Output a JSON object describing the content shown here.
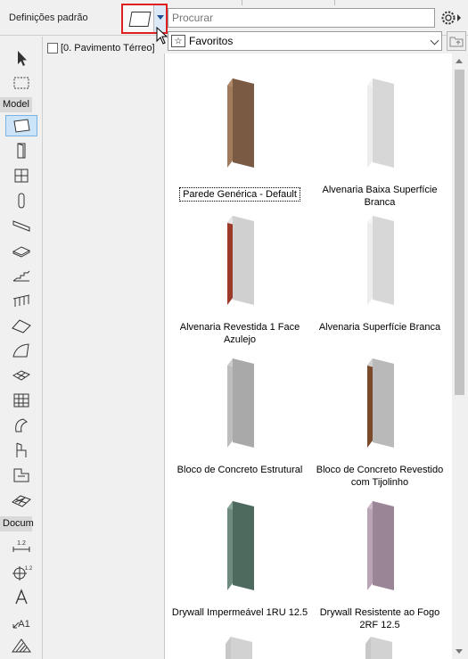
{
  "header": {
    "title": "Definições padrão",
    "search_placeholder": "Procurar",
    "favorites_label": "Favoritos",
    "default_tool_icon": "wall-icon"
  },
  "story": {
    "label": "[0. Pavimento Térreo]"
  },
  "toolbox": {
    "sections": [
      {
        "label": "Model"
      },
      {
        "label": "Docum"
      }
    ],
    "tools": [
      "arrow-icon",
      "marquee-icon",
      "wall-icon",
      "door-icon",
      "window-icon",
      "column-icon",
      "beam-icon",
      "slab-icon",
      "stair-icon",
      "railing-icon",
      "roof-icon",
      "shell-icon",
      "mesh-icon",
      "curtain-wall-icon",
      "morph-icon",
      "object-icon",
      "zone-icon",
      "mesh-surface-icon",
      "dimension-icon",
      "level-dimension-icon",
      "text-icon",
      "label-icon",
      "fill-icon"
    ],
    "dimension_value": "1.2"
  },
  "favorites": [
    {
      "name": "Parede Genérica - Default",
      "colors": {
        "face": "#7a5a43",
        "side": "#a07a5a",
        "top": "#b08866"
      }
    },
    {
      "name": "Alvenaria Baixa Superfície Branca",
      "colors": {
        "face": "#d7d7d7",
        "side": "#ececec",
        "top": "#f4f4f4"
      }
    },
    {
      "name": "Alvenaria Revestida 1 Face Azulejo",
      "colors": {
        "face": "#d0d0d0",
        "side": "#9b3a28",
        "top": "#e6e6e6"
      }
    },
    {
      "name": "Alvenaria Superfície Branca",
      "colors": {
        "face": "#d7d7d7",
        "side": "#ececec",
        "top": "#f4f4f4"
      }
    },
    {
      "name": "Bloco de Concreto Estrutural",
      "colors": {
        "face": "#a9a9a9",
        "side": "#bdbdbd",
        "top": "#cdcdcd"
      }
    },
    {
      "name": "Bloco de Concreto Revestido com Tijolinho",
      "colors": {
        "face": "#b9b9b9",
        "side": "#7b4a2a",
        "top": "#d0d0d0"
      }
    },
    {
      "name": "Drywall Impermeável 1RU 12.5",
      "colors": {
        "face": "#4e6a5f",
        "side": "#6d8a7e",
        "top": "#8aa397"
      }
    },
    {
      "name": "Drywall Resistente ao Fogo 2RF 12.5",
      "colors": {
        "face": "#9a8597",
        "side": "#b8a4b5",
        "top": "#c9b8c6"
      }
    }
  ]
}
